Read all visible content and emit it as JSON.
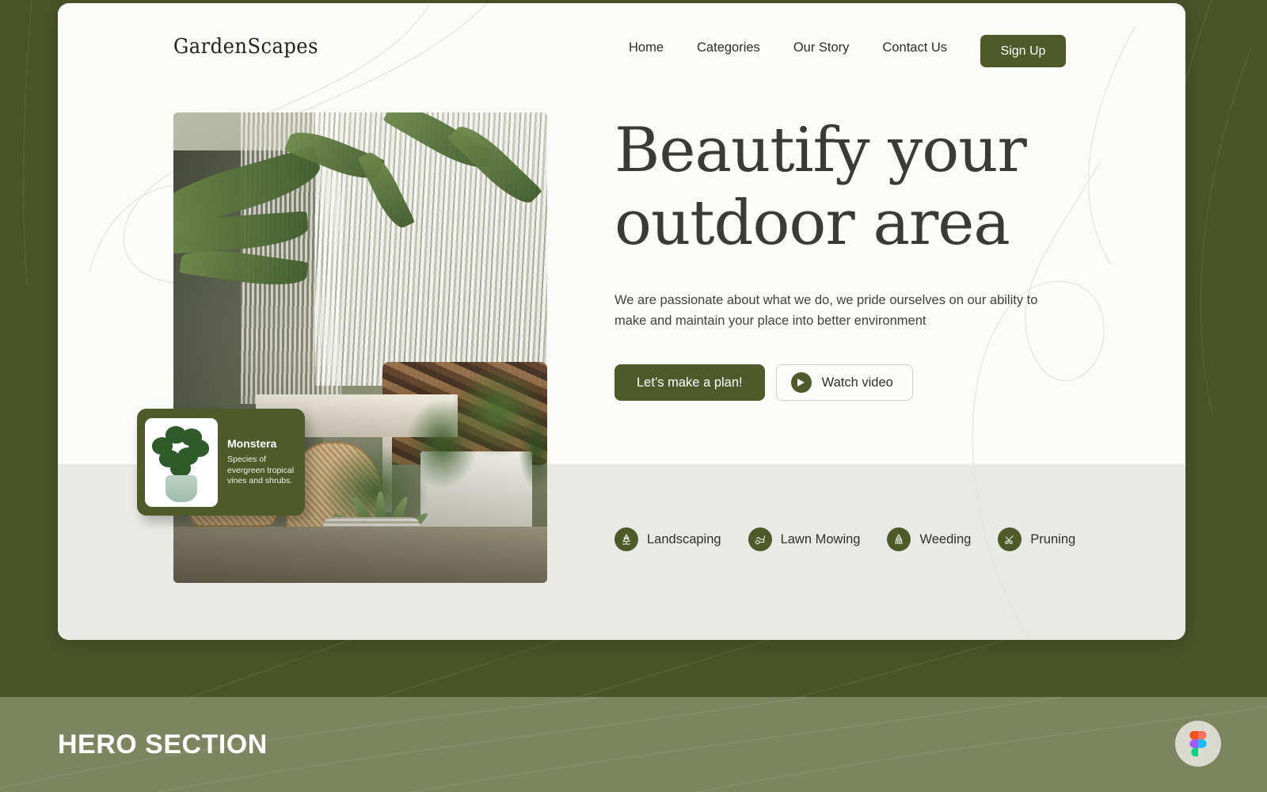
{
  "brand": {
    "logo": "GardenScapes"
  },
  "nav": {
    "items": [
      {
        "label": "Home"
      },
      {
        "label": "Categories"
      },
      {
        "label": "Our Story"
      },
      {
        "label": "Contact Us"
      }
    ],
    "cta_label": "Sign Up"
  },
  "hero": {
    "headline_line1": "Beautify your",
    "headline_line2": "outdoor area",
    "subtext": "We are passionate about what we do, we pride ourselves on our ability to make and maintain your place into better environment",
    "primary_cta": "Let’s make a plan!",
    "secondary_cta": "Watch video"
  },
  "plant_card": {
    "title": "Monstera",
    "description": "Species of evergreen tropical vines and shrubs.",
    "thumb_alt": "monstera-plant-photo"
  },
  "services": [
    {
      "label": "Landscaping",
      "icon": "landscaping-icon"
    },
    {
      "label": "Lawn Mowing",
      "icon": "lawn-mowing-icon"
    },
    {
      "label": "Weeding",
      "icon": "weeding-icon"
    },
    {
      "label": "Pruning",
      "icon": "pruning-icon"
    }
  ],
  "caption_bar": {
    "title": "HERO SECTION",
    "badge": "figma-logo"
  },
  "colors": {
    "page_background": "#4a5429",
    "card_background": "#fbfbfa",
    "lower_band": "#e9e9e5",
    "accent_olive": "#4e5a2a",
    "caption_bar": "#7c8460",
    "heading_text": "#3a3a36",
    "body_text": "#3f423c"
  }
}
